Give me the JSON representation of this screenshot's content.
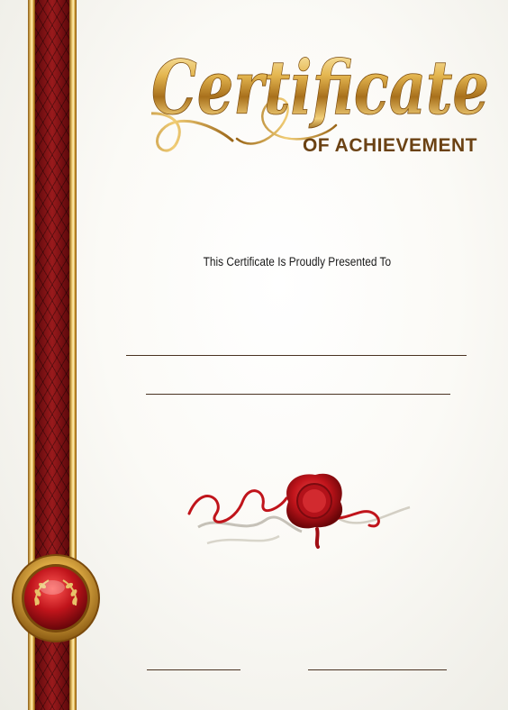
{
  "certificate": {
    "title_script": "Certificate",
    "subtitle": "OF ACHIEVEMENT",
    "presented_line": "This Certificate Is Proudly Presented To"
  },
  "colors": {
    "gold": "#d4a640",
    "ribbon_red": "#7a0f12",
    "seal_red": "#c0141b",
    "subtitle_brown": "#6b4214",
    "line_color": "#4a3322"
  },
  "icons": {
    "wax_seal": "wax-seal-icon",
    "medal": "medal-emblem-icon"
  }
}
